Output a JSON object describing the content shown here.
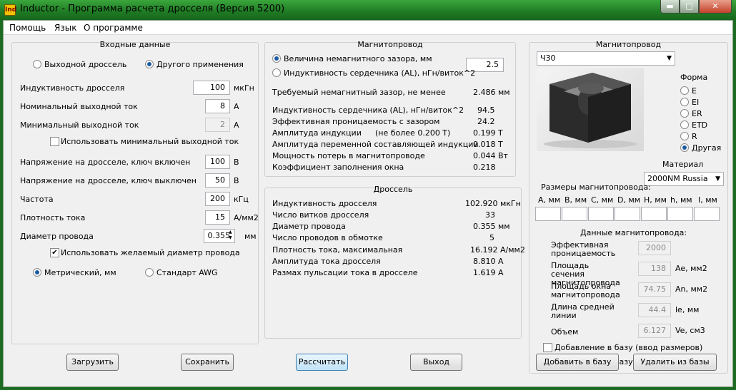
{
  "window": {
    "title": "Inductor - Программа расчета дросселя (Версия 5200)",
    "icon_text": "Ind"
  },
  "menu": [
    "Помощь",
    "Язык",
    "О программе"
  ],
  "input": {
    "title": "Входные данные",
    "radio_output": "Выходной дроссель",
    "radio_other": "Другого применения",
    "inductance": {
      "label": "Индуктивность дросселя",
      "value": "100",
      "unit": "мкГн"
    },
    "nom_current": {
      "label": "Номинальный выходной ток",
      "value": "8",
      "unit": "А"
    },
    "min_current": {
      "label": "Минимальный выходной ток",
      "value": "2",
      "unit": "А"
    },
    "use_min": "Использовать минимальный выходной ток",
    "v_on": {
      "label": "Напряжение на дросселе, ключ включен",
      "value": "100",
      "unit": "В"
    },
    "v_off": {
      "label": "Напряжение на дросселе, ключ выключен",
      "value": "50",
      "unit": "В"
    },
    "freq": {
      "label": "Частота",
      "value": "200",
      "unit": "кГц"
    },
    "density": {
      "label": "Плотность тока",
      "value": "15",
      "unit": "А/мм2"
    },
    "wire": {
      "label": "Диаметр провода",
      "value": "0.355",
      "unit": "мм"
    },
    "use_wire": "Использовать желаемый диаметр провода",
    "metric": "Метрический, мм",
    "awg": "Стандарт AWG"
  },
  "core": {
    "title": "Магнитопровод",
    "gap_radio": "Величина немагнитного зазора, мм",
    "gap_value": "2.5",
    "al_radio": "Индуктивность сердечника (AL), нГн/виток^2",
    "rows": [
      {
        "label": "Требуемый немагнитный зазор, не менее",
        "value": "2.486 мм"
      },
      {
        "label": "Индуктивность сердечника (AL), нГн/виток^2",
        "value": "94.5"
      },
      {
        "label": "Эффективная проницаемость с зазором",
        "value": "24.2"
      },
      {
        "label": "Амплитуда индукции",
        "note": "(не более 0.200 Т)",
        "value": "0.199 Т"
      },
      {
        "label": "Амплитуда переменной составляющей индукции",
        "value": "0.018 Т"
      },
      {
        "label": "Мощность потерь в магнитопроводе",
        "value": "0.044 Вт"
      },
      {
        "label": "Коэффициент заполнения окна",
        "value": "0.218"
      }
    ]
  },
  "inductor": {
    "title": "Дроссель",
    "rows": [
      {
        "label": "Индуктивность дросселя",
        "value": "102.920 мкГн"
      },
      {
        "label": "Число витков дросселя",
        "value": "33"
      },
      {
        "label": "Диаметр провода",
        "value": "0.355 мм"
      },
      {
        "label": "Число проводов в обмотке",
        "value": "5"
      },
      {
        "label": "Плотность тока, максимальная",
        "value": "16.192 А/мм2"
      },
      {
        "label": "Амплитуда тока дросселя",
        "value": "8.810 А"
      },
      {
        "label": "Размах пульсации тока в дросселе",
        "value": "1.619 А"
      }
    ]
  },
  "right": {
    "title": "Магнитопровод",
    "core_select": "Ч30",
    "shape_title": "Форма",
    "shapes": [
      "E",
      "EI",
      "ER",
      "ETD",
      "R",
      "Другая"
    ],
    "material_title": "Материал",
    "material": "2000NM Russia",
    "dims_title": "Размеры магнитопровода:",
    "dims": [
      "A, мм",
      "B, мм",
      "C, мм",
      "D, мм",
      "H, мм",
      "h, мм",
      "I, мм"
    ],
    "data_title": "Данные магнитопровода:",
    "params": [
      {
        "label": "Эффективная проницаемость",
        "value": "2000",
        "unit": ""
      },
      {
        "label": "Площадь сечения магнитопровода",
        "value": "138",
        "unit": "Ae, мм2"
      },
      {
        "label": "Площадь окна магнитопровода",
        "value": "74.75",
        "unit": "An, мм2"
      },
      {
        "label": "Длина средней линии",
        "value": "44.4",
        "unit": "le, мм"
      },
      {
        "label": "Объем",
        "value": "6.127",
        "unit": "Ve, см3"
      }
    ],
    "add_dims": "Добавление в базу (ввод размеров)",
    "add_data": "Добавление в базу (ввод данных)",
    "btn_add": "Добавить в базу",
    "btn_delete": "Удалить из базы"
  },
  "buttons": {
    "load": "Загрузить",
    "save": "Сохранить",
    "calc": "Рассчитать",
    "exit": "Выход"
  }
}
